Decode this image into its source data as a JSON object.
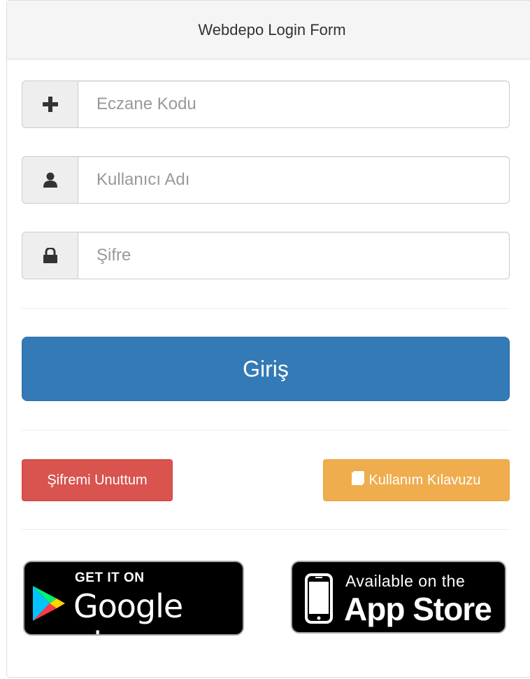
{
  "panel": {
    "heading": "Webdepo Login Form"
  },
  "form": {
    "pharmacy_code": {
      "placeholder": "Eczane Kodu",
      "value": ""
    },
    "username": {
      "placeholder": "Kullanıcı Adı",
      "value": ""
    },
    "password": {
      "placeholder": "Şifre",
      "value": ""
    },
    "login_label": "Giriş"
  },
  "links": {
    "forgot_password": "Şifremi Unuttum",
    "user_guide": "Kullanım Kılavuzu"
  },
  "badges": {
    "google_small": "GET IT ON",
    "google_big": "Google play",
    "apple_small": "Available on the",
    "apple_big": "App Store"
  },
  "icons": {
    "pharmacy_code": "plus-icon",
    "username": "user-icon",
    "password": "lock-icon",
    "user_guide": "book-icon",
    "google_play": "play-triangle-icon",
    "app_store": "phone-icon"
  },
  "colors": {
    "primary": "#337ab7",
    "danger": "#d9534f",
    "warning": "#f0ad4e",
    "heading_bg": "#f5f5f5"
  }
}
